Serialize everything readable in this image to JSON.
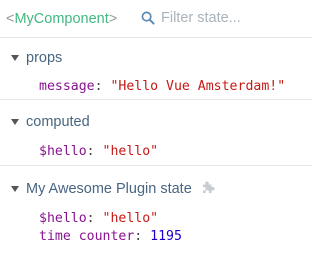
{
  "header": {
    "open_bracket": "<",
    "component_name": "MyComponent",
    "close_bracket": ">",
    "search_placeholder": "Filter state..."
  },
  "sections": [
    {
      "title": "props",
      "rows": [
        {
          "key": "message",
          "value": "\"Hello Vue Amsterdam!\""
        }
      ]
    },
    {
      "title": "computed",
      "rows": [
        {
          "key": "$hello",
          "value": "\"hello\""
        }
      ]
    },
    {
      "title": "My Awesome Plugin state",
      "icon": "puzzle-icon",
      "rows": [
        {
          "key": "$hello",
          "value": "\"hello\""
        },
        {
          "key": "time counter",
          "value": "1195"
        }
      ]
    }
  ],
  "colors": {
    "component_name": "#42b983",
    "section_title": "#486581",
    "key": "#881391",
    "string": "#c41a16",
    "number": "#1c00cf"
  }
}
